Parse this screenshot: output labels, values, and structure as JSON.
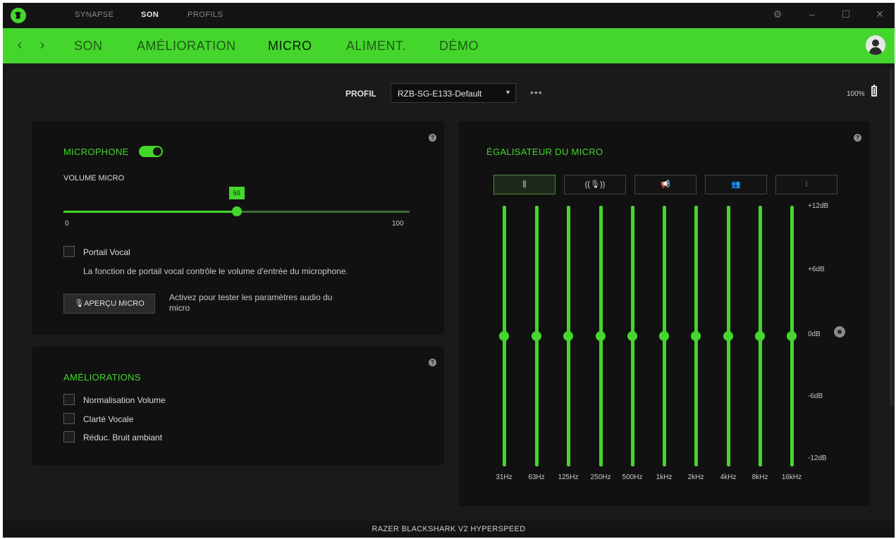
{
  "titlebar": {
    "tabs": [
      {
        "label": "SYNAPSE",
        "active": false
      },
      {
        "label": "SON",
        "active": true
      },
      {
        "label": "PROFILS",
        "active": false
      }
    ],
    "controls": [
      "gear-icon",
      "minimize-icon",
      "maximize-icon",
      "close-icon"
    ]
  },
  "nav": {
    "tabs": [
      {
        "label": "SON",
        "active": false
      },
      {
        "label": "AMÉLIORATION",
        "active": false
      },
      {
        "label": "MICRO",
        "active": true
      },
      {
        "label": "ALIMENT.",
        "active": false
      },
      {
        "label": "DÉMO",
        "active": false
      }
    ]
  },
  "profile": {
    "label": "PROFIL",
    "selected": "RZB-SG-E133-Default",
    "more": "•••",
    "battery": "100%"
  },
  "microphone": {
    "title": "MICROPHONE",
    "enabled": true,
    "volume_label": "VOLUME MICRO",
    "volume_value": "50",
    "volume_min": "0",
    "volume_max": "100",
    "voice_gate_label": "Portail Vocal",
    "voice_gate_checked": false,
    "voice_gate_desc": "La fonction de portail vocal contrôle le volume d'entrée du microphone.",
    "preview_button": "APERÇU MICRO",
    "preview_desc_1": "Activez pour tester les paramètres audio du",
    "preview_desc_2": "micro"
  },
  "enhancements": {
    "title": "AMÉLIORATIONS",
    "items": [
      {
        "label": "Normalisation Volume",
        "checked": false
      },
      {
        "label": "Clarté Vocale",
        "checked": false
      },
      {
        "label": "Réduc. Bruit ambiant",
        "checked": false
      }
    ]
  },
  "equalizer": {
    "title": "ÉGALISATEUR DU MICRO",
    "presets": [
      {
        "icon": "equalizer-sliders-icon",
        "glyph": "⫼",
        "active": true
      },
      {
        "icon": "microphone-wave-icon",
        "glyph": "((🎙))",
        "active": false
      },
      {
        "icon": "megaphone-icon",
        "glyph": "📢",
        "active": false
      },
      {
        "icon": "people-icon",
        "glyph": "👥",
        "active": false
      },
      {
        "icon": "custom-sliders-icon",
        "glyph": "⫶",
        "active": false
      }
    ],
    "bands": [
      "31Hz",
      "63Hz",
      "125Hz",
      "250Hz",
      "500Hz",
      "1kHz",
      "2kHz",
      "4kHz",
      "8kHz",
      "16kHz"
    ],
    "gains_db": [
      0,
      0,
      0,
      0,
      0,
      0,
      0,
      0,
      0,
      0
    ],
    "scale": [
      "+12dB",
      "+6dB",
      "0dB",
      "-6dB",
      "-12dB"
    ],
    "range_db": [
      -12,
      12
    ]
  },
  "footer": {
    "device": "RAZER BLACKSHARK V2 HYPERSPEED"
  },
  "colors": {
    "accent": "#44d62c",
    "background": "#1a1a1a",
    "panel": "#111111"
  }
}
